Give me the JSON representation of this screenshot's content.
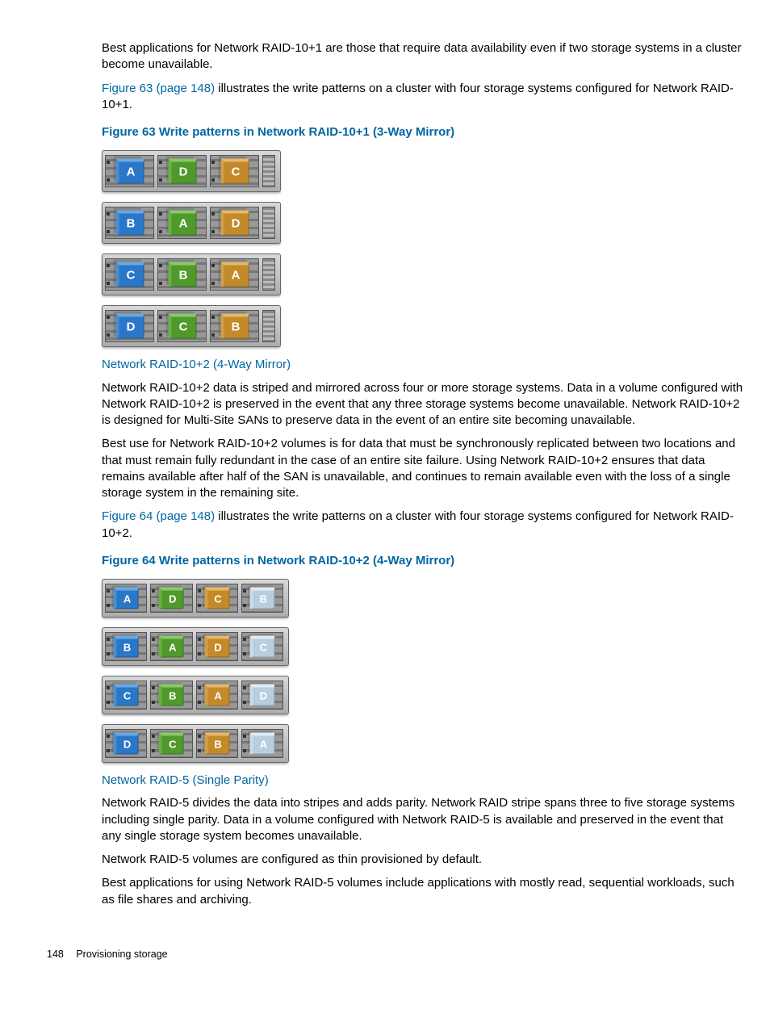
{
  "para1": "Best applications for Network RAID-10+1 are those that require data availability even if two storage systems in a cluster become unavailable.",
  "link63": "Figure 63 (page 148)",
  "para2_tail": " illustrates the write patterns on a cluster with four storage systems configured for Network RAID-10+1.",
  "fig63_cap": "Figure 63 Write patterns in Network RAID-10+1 (3-Way Mirror)",
  "fig63": {
    "r1": [
      "A",
      "D",
      "C"
    ],
    "r2": [
      "B",
      "A",
      "D"
    ],
    "r3": [
      "C",
      "B",
      "A"
    ],
    "r4": [
      "D",
      "C",
      "B"
    ]
  },
  "sub1": "Network RAID-10+2 (4-Way Mirror)",
  "para3": "Network RAID-10+2 data is striped and mirrored across four or more storage systems. Data in a volume configured with Network RAID-10+2 is preserved in the event that any three storage systems become unavailable. Network RAID-10+2 is designed for Multi-Site SANs to preserve data in the event of an entire site becoming unavailable.",
  "para4": "Best use for Network RAID-10+2 volumes is for data that must be synchronously replicated between two locations and that must remain fully redundant in the case of an entire site failure. Using Network RAID-10+2 ensures that data remains available after half of the SAN is unavailable, and continues to remain available even with the loss of a single storage system in the remaining site.",
  "link64": "Figure 64 (page 148)",
  "para5_tail": " illustrates the write patterns on a cluster with four storage systems configured for Network RAID-10+2.",
  "fig64_cap": "Figure 64 Write patterns in Network RAID-10+2 (4-Way Mirror)",
  "fig64": {
    "r1": [
      "A",
      "D",
      "C",
      "B"
    ],
    "r2": [
      "B",
      "A",
      "D",
      "C"
    ],
    "r3": [
      "C",
      "B",
      "A",
      "D"
    ],
    "r4": [
      "D",
      "C",
      "B",
      "A"
    ]
  },
  "sub2": "Network RAID-5 (Single Parity)",
  "para6": "Network RAID-5 divides the data into stripes and adds parity. Network RAID stripe spans three to five storage systems including single parity. Data in a volume configured with Network RAID-5 is available and preserved in the event that any single storage system becomes unavailable.",
  "para7": "Network RAID-5 volumes are configured as thin provisioned by default.",
  "para8": "Best applications for using Network RAID-5 volumes include applications with mostly read, sequential workloads, such as file shares and archiving.",
  "page_num": "148",
  "footer_txt": "Provisioning storage"
}
